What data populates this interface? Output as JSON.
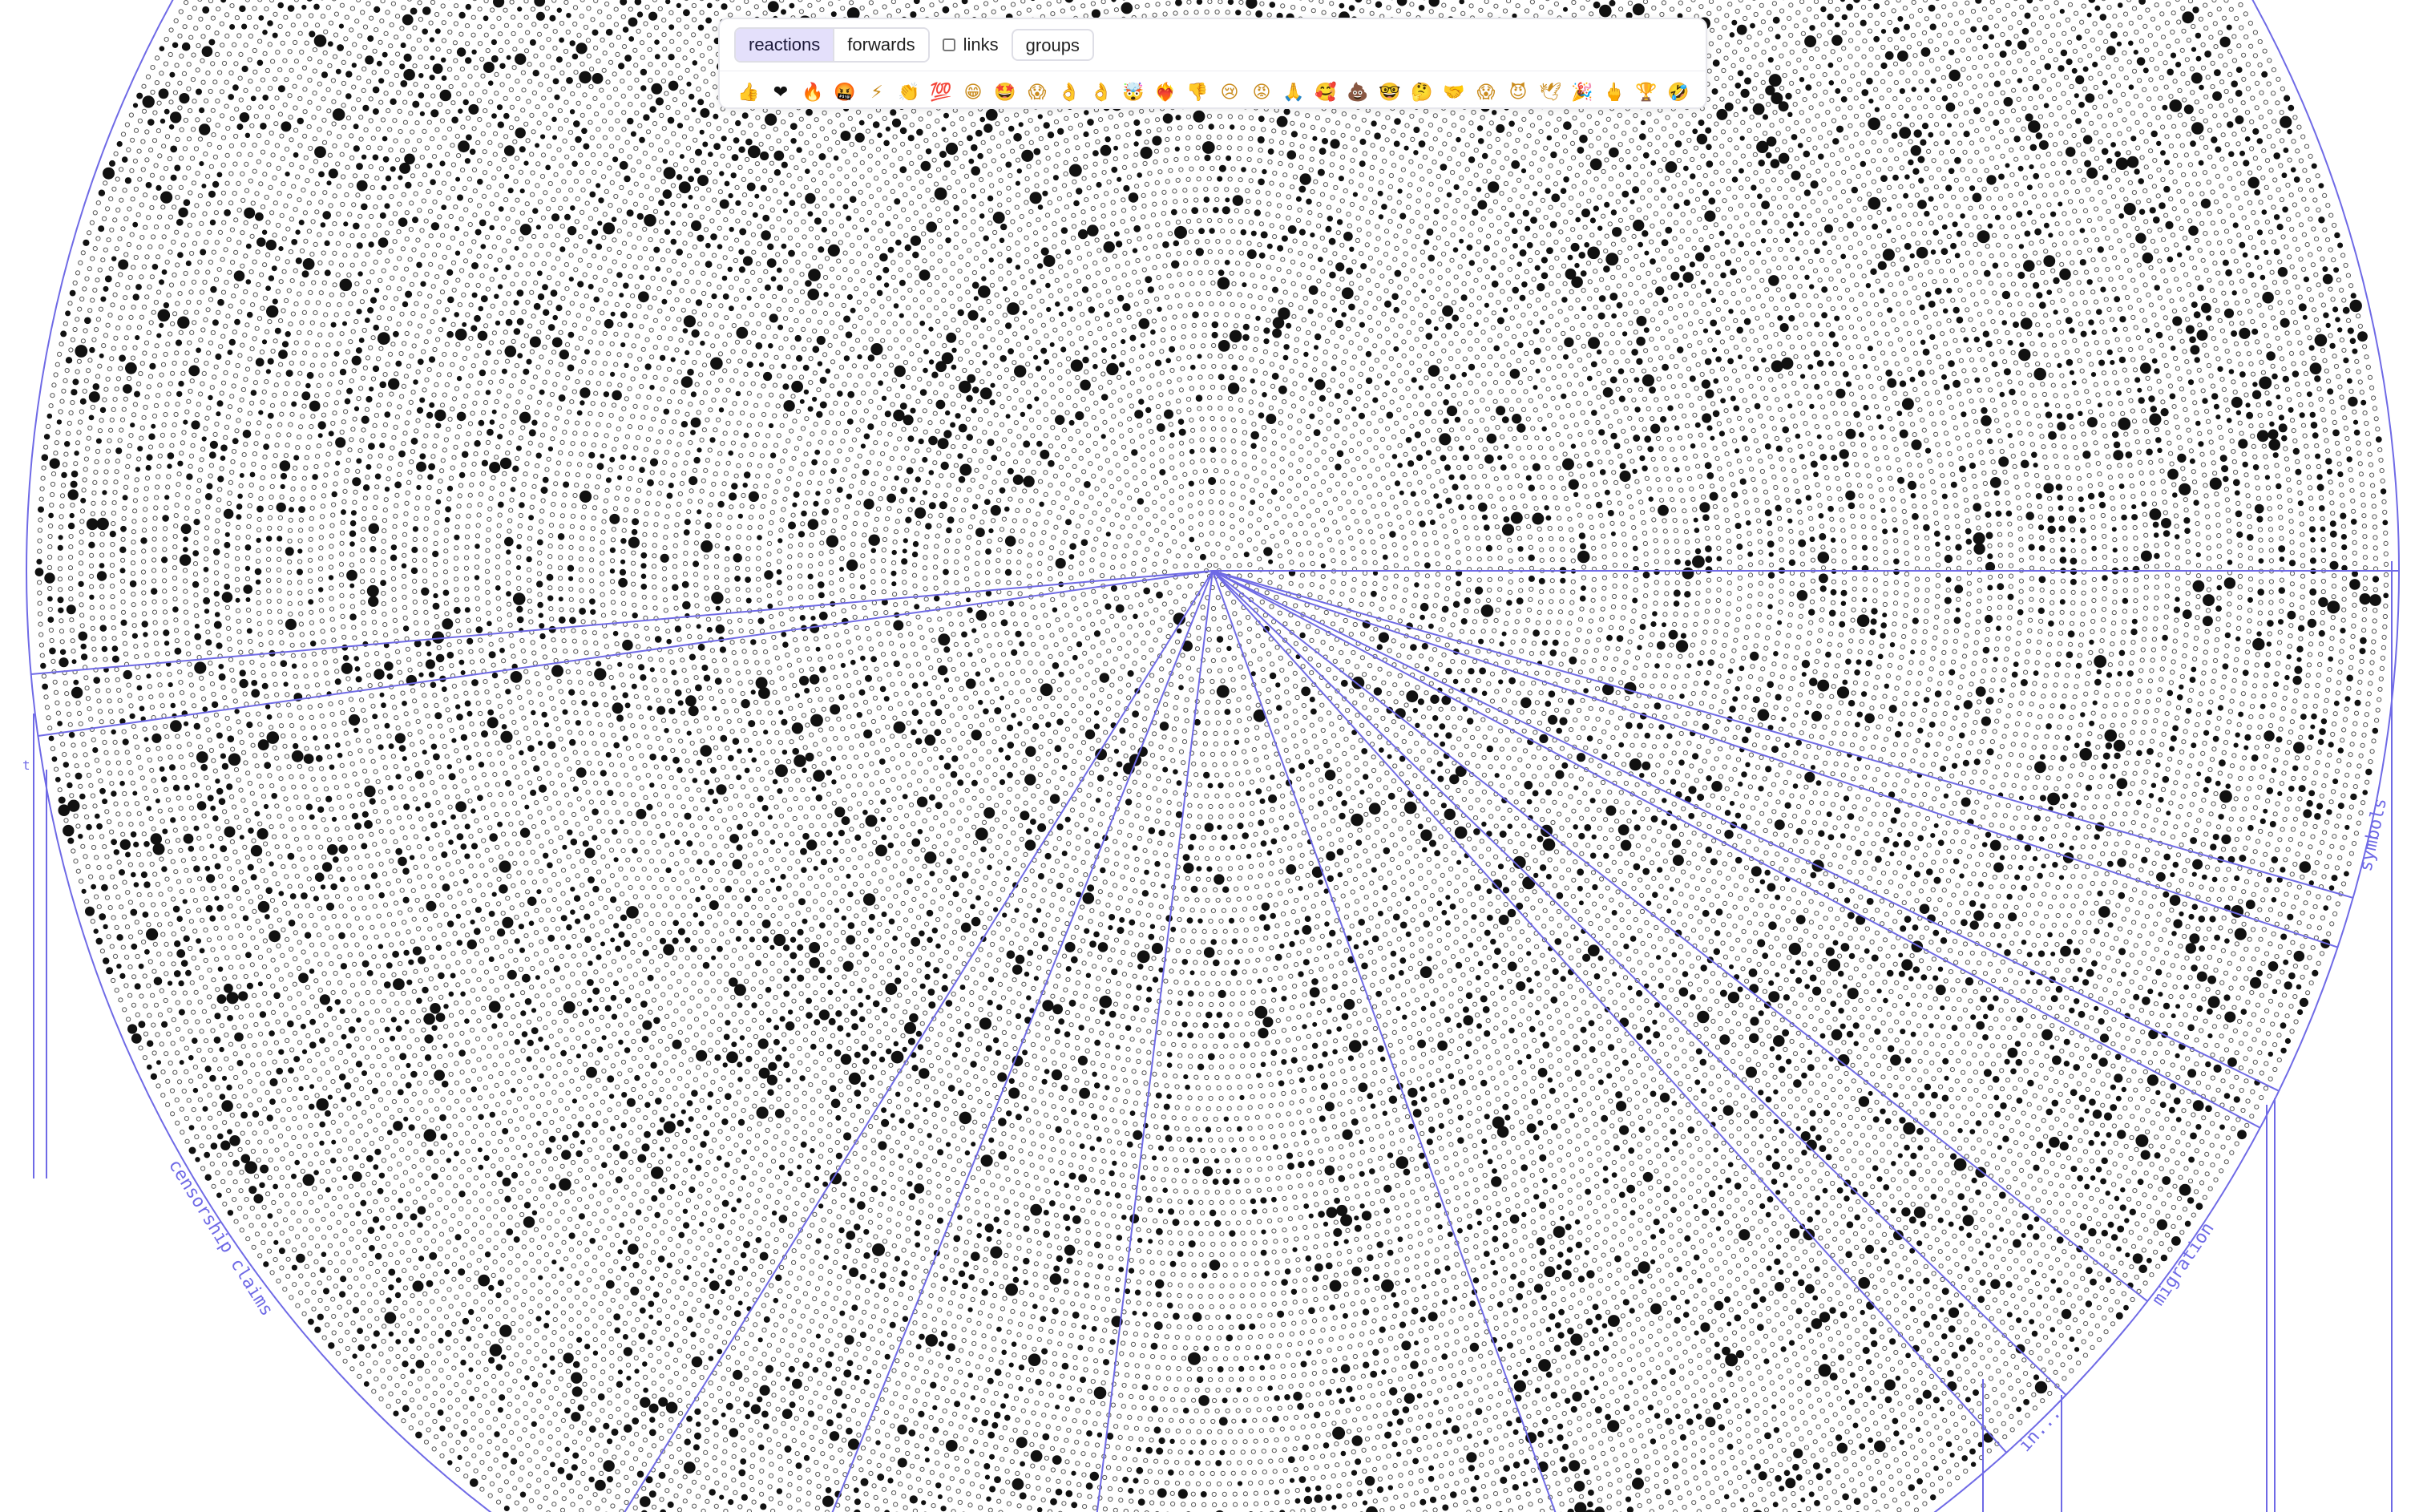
{
  "toolbar": {
    "tabs": [
      {
        "label": "reactions",
        "active": true
      },
      {
        "label": "forwards",
        "active": false
      }
    ],
    "links_checkbox": {
      "label": "links",
      "checked": false
    },
    "groups_button": {
      "label": "groups"
    },
    "emoji_filters": [
      "👍",
      "❤",
      "🔥",
      "🤬",
      "⚡",
      "👏",
      "💯",
      "😁",
      "🤩",
      "😱",
      "👌",
      "👌",
      "🤯",
      "❤️‍🔥",
      "👎",
      "😢",
      "😡",
      "🙏",
      "🥰",
      "💩",
      "🤓",
      "🤔",
      "🤝",
      "😱",
      "😈",
      "🕊",
      "🎉",
      "🖕",
      "🏆",
      "🤣"
    ],
    "selected_emoji_index": 1
  },
  "visualization": {
    "accent_color": "#6f6ae6",
    "dot_color": "#111111",
    "segment_labels": [
      "censorship claims",
      "symbols",
      "migration",
      "in...",
      "t"
    ]
  }
}
